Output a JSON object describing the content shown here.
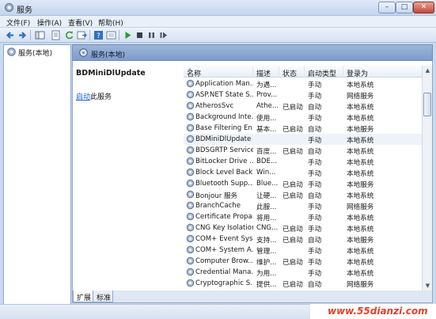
{
  "window": {
    "title": "服务",
    "min": "–",
    "max": "□",
    "close": "✕"
  },
  "menu": [
    "文件(F)",
    "操作(A)",
    "查看(V)",
    "帮助(H)"
  ],
  "tree": {
    "root": "服务(本地)"
  },
  "header": {
    "title": "服务(本地)"
  },
  "extended": {
    "service_name": "BDMiniDlUpdate",
    "action_link": "启动",
    "action_suffix": "此服务"
  },
  "columns": [
    "名称",
    "描述",
    "状态",
    "启动类型",
    "登录为"
  ],
  "sort_indicator": "^",
  "rows": [
    {
      "name": "Application Man...",
      "desc": "为遇...",
      "status": "",
      "startup": "手动",
      "logon": "本地系统"
    },
    {
      "name": "ASP.NET State S...",
      "desc": "Prov...",
      "status": "",
      "startup": "手动",
      "logon": "网络服务"
    },
    {
      "name": "AtherosSvc",
      "desc": "Athe...",
      "status": "已启动",
      "startup": "自动",
      "logon": "本地系统"
    },
    {
      "name": "Background Inte...",
      "desc": "使用...",
      "status": "",
      "startup": "手动",
      "logon": "本地系统"
    },
    {
      "name": "Base Filtering En...",
      "desc": "基本...",
      "status": "已启动",
      "startup": "自动",
      "logon": "本地服务"
    },
    {
      "name": "BDMiniDlUpdate",
      "desc": "",
      "status": "",
      "startup": "手动",
      "logon": "本地系统"
    },
    {
      "name": "BDSGRTP Service",
      "desc": "百度...",
      "status": "已启动",
      "startup": "自动",
      "logon": "本地系统"
    },
    {
      "name": "BitLocker Drive ...",
      "desc": "BDE...",
      "status": "",
      "startup": "手动",
      "logon": "本地系统"
    },
    {
      "name": "Block Level Back...",
      "desc": "Win...",
      "status": "",
      "startup": "手动",
      "logon": "本地系统"
    },
    {
      "name": "Bluetooth Supp...",
      "desc": "Blue...",
      "status": "已启动",
      "startup": "手动",
      "logon": "本地服务"
    },
    {
      "name": "Bonjour 服务",
      "desc": "让硬...",
      "status": "已启动",
      "startup": "自动",
      "logon": "本地系统"
    },
    {
      "name": "BranchCache",
      "desc": "此服...",
      "status": "",
      "startup": "手动",
      "logon": "网络服务"
    },
    {
      "name": "Certificate Propa...",
      "desc": "将用...",
      "status": "",
      "startup": "手动",
      "logon": "本地系统"
    },
    {
      "name": "CNG Key Isolation",
      "desc": "CNG...",
      "status": "已启动",
      "startup": "手动",
      "logon": "本地系统"
    },
    {
      "name": "COM+ Event Sys...",
      "desc": "支持...",
      "status": "已启动",
      "startup": "自动",
      "logon": "本地服务"
    },
    {
      "name": "COM+ System A...",
      "desc": "管理...",
      "status": "",
      "startup": "手动",
      "logon": "本地系统"
    },
    {
      "name": "Computer Brow...",
      "desc": "维护...",
      "status": "已启动",
      "startup": "手动",
      "logon": "本地系统"
    },
    {
      "name": "Credential Mana...",
      "desc": "为用...",
      "status": "",
      "startup": "手动",
      "logon": "本地系统"
    },
    {
      "name": "Cryptographic S...",
      "desc": "提供...",
      "status": "已启动",
      "startup": "自动",
      "logon": "网络服务"
    }
  ],
  "tabs": [
    "扩展",
    "标准"
  ],
  "watermark": "www.55dianzi.com",
  "colors": {
    "link": "#1a5ad7",
    "header_band": "#8aa6d1",
    "watermark": "#e0412c"
  }
}
